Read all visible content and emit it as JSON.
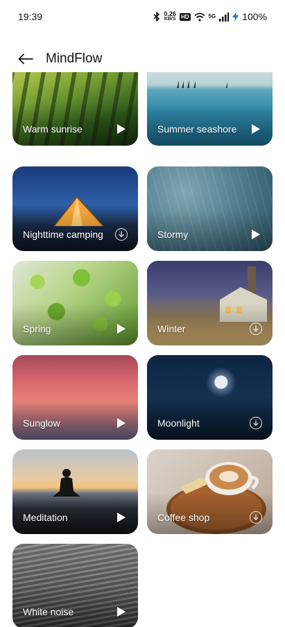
{
  "status": {
    "time": "19:39",
    "net_speed_value": "0.26",
    "net_speed_unit": "KB/S",
    "hd": "HD",
    "signal_gen": "5G",
    "battery": "100%"
  },
  "header": {
    "title": "MindFlow"
  },
  "sounds": [
    {
      "label": "Warm sunrise",
      "action": "play"
    },
    {
      "label": "Summer seashore",
      "action": "play"
    },
    {
      "label": "Nighttime camping",
      "action": "download"
    },
    {
      "label": "Stormy",
      "action": "play"
    },
    {
      "label": "Spring",
      "action": "play"
    },
    {
      "label": "Winter",
      "action": "download"
    },
    {
      "label": "Sunglow",
      "action": "play"
    },
    {
      "label": "Moonlight",
      "action": "download"
    },
    {
      "label": "Meditation",
      "action": "play"
    },
    {
      "label": "Coffee shop",
      "action": "download"
    },
    {
      "label": "White noise",
      "action": "play"
    }
  ]
}
